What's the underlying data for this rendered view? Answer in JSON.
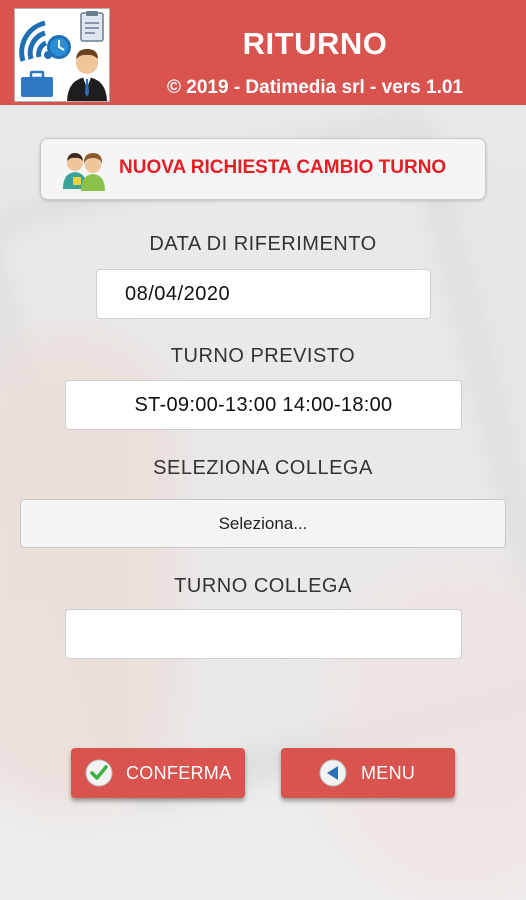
{
  "header": {
    "title": "RITURNO",
    "subtitle": "© 2019 - Datimedia srl - vers 1.01",
    "logo_icon": "app-logo-icon",
    "accent_color": "#d9534f"
  },
  "new_request": {
    "label": "NUOVA RICHIESTA CAMBIO TURNO",
    "icon": "two-people-icon",
    "label_color": "#e31e24"
  },
  "form": {
    "reference_date": {
      "label": "DATA DI RIFERIMENTO",
      "value": "08/04/2020"
    },
    "planned_shift": {
      "label": "TURNO PREVISTO",
      "value": "ST-09:00-13:00 14:00-18:00"
    },
    "colleague": {
      "label": "SELEZIONA COLLEGA",
      "selected": "Seleziona..."
    },
    "colleague_shift": {
      "label": "TURNO COLLEGA",
      "value": ""
    }
  },
  "actions": {
    "confirm": {
      "label": "CONFERMA",
      "icon": "check-circle-icon"
    },
    "menu": {
      "label": "MENU",
      "icon": "back-arrow-icon"
    }
  }
}
